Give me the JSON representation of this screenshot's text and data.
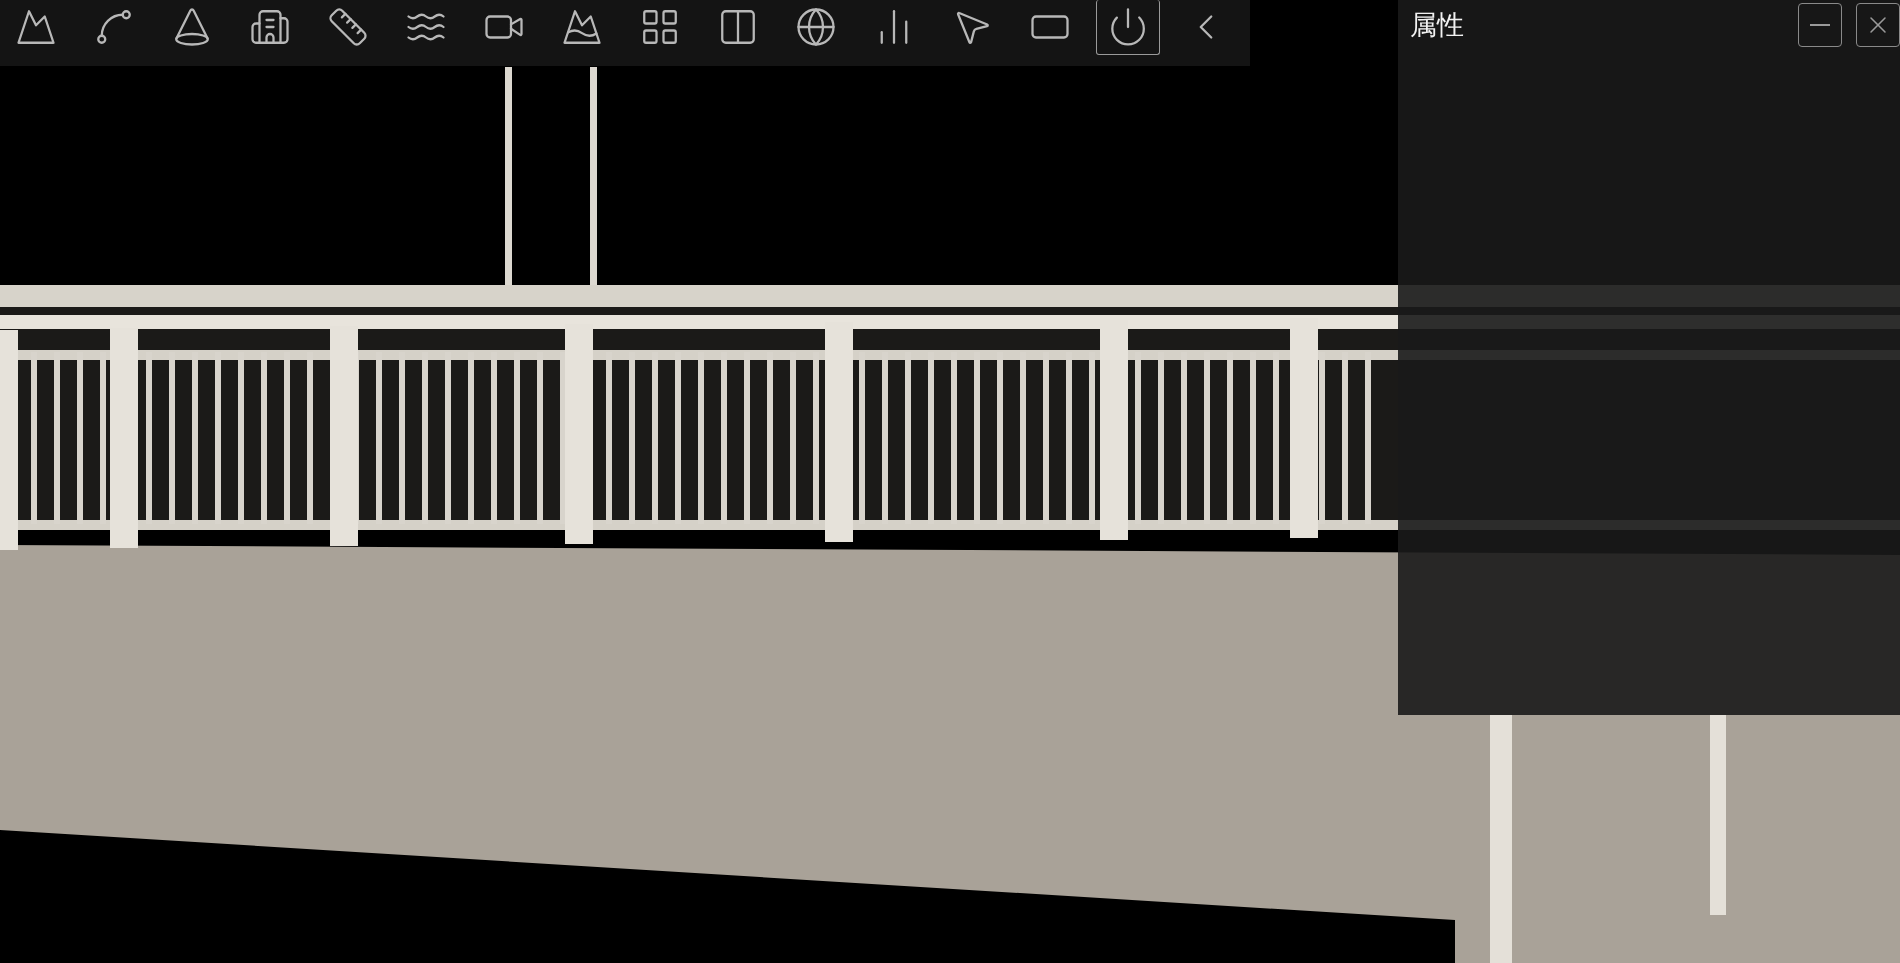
{
  "toolbar": {
    "tools": [
      {
        "kind": "terrain",
        "selected": false
      },
      {
        "kind": "path",
        "selected": false
      },
      {
        "kind": "projection",
        "selected": false
      },
      {
        "kind": "city",
        "selected": false
      },
      {
        "kind": "ruler",
        "selected": false
      },
      {
        "kind": "water",
        "selected": false
      },
      {
        "kind": "video",
        "selected": false
      },
      {
        "kind": "peaks",
        "selected": false
      },
      {
        "kind": "grid",
        "selected": false
      },
      {
        "kind": "split",
        "selected": false
      },
      {
        "kind": "dome",
        "selected": false
      },
      {
        "kind": "profile",
        "selected": false
      },
      {
        "kind": "pointer",
        "selected": false
      },
      {
        "kind": "board",
        "selected": false
      },
      {
        "kind": "power",
        "selected": true
      },
      {
        "kind": "collapse",
        "selected": false
      }
    ]
  },
  "properties_panel": {
    "title": "属性",
    "buttons": [
      {
        "kind": "minimize"
      },
      {
        "kind": "close"
      }
    ]
  }
}
